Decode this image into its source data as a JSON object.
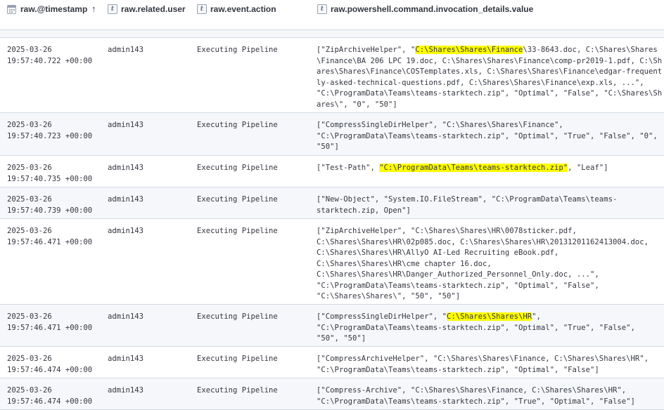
{
  "columns": [
    {
      "label": "raw.@timestamp",
      "type_icon": "calendar-icon",
      "sort": "ascending"
    },
    {
      "label": "raw.related.user",
      "type_icon": "text-type-icon"
    },
    {
      "label": "raw.event.action",
      "type_icon": "text-type-icon"
    },
    {
      "label": "raw.powershell.command.invocation_details.value",
      "type_icon": "text-type-icon"
    }
  ],
  "partial_row_fragment": "...\" ...\"",
  "highlight_color": "#fdfd00",
  "rows": [
    {
      "timestamp_date": "2025-03-26",
      "timestamp_time": "19:57:40.722 +00:00",
      "user": "admin143",
      "action": "Executing Pipeline",
      "value_before": "[\"ZipArchiveHelper\", \"",
      "value_highlight": "C:\\Shares\\Shares\\Finance",
      "value_after": "\\33-8643.doc, C:\\Shares\\Shares\\Finance\\BA 206 LPC 19.doc, C:\\Shares\\Shares\\Finance\\comp-pr2019-1.pdf, C:\\Shares\\Shares\\Finance\\COSTemplates.xls, C:\\Shares\\Shares\\Finance\\edgar-frequently-asked-technical-questions.pdf, C:\\Shares\\Shares\\Finance\\exp.xls, ...\", \"C:\\ProgramData\\Teams\\teams-starktech.zip\", \"Optimal\", \"False\", \"C:\\Shares\\Shares\\\", \"0\", \"50\"]",
      "value_lines": [
        "[\"ZipArchiveHelper\", \"",
        "C:\\Shares\\Shares\\Finance\\BA 206 LPC 19.doc, C:\\Shares\\Shares\\Finance\\comp-",
        "pr2019-1.pdf, C:\\Shares\\Shares\\Finance\\COSTemplates.xls,",
        "C:\\Shares\\Shares\\Finance\\edgar-frequently-asked-technical-questions.pdf,",
        "C:\\Shares\\Shares\\Finance\\exp.xls, ...\", \"C:\\ProgramData\\Teams\\teams-",
        "starktech.zip\", \"Optimal\", \"False\", \"C:\\Shares\\Shares\\\", \"0\", \"50\"]"
      ]
    },
    {
      "timestamp_date": "2025-03-26",
      "timestamp_time": "19:57:40.723 +00:00",
      "user": "admin143",
      "action": "Executing Pipeline",
      "value_lines": [
        "[\"CompressSingleDirHelper\", \"C:\\Shares\\Shares\\Finance\",",
        "\"C:\\ProgramData\\Teams\\teams-starktech.zip\", \"Optimal\", \"True\", \"False\", \"0\",",
        "\"50\"]"
      ]
    },
    {
      "timestamp_date": "2025-03-26",
      "timestamp_time": "19:57:40.735 +00:00",
      "user": "admin143",
      "action": "Executing Pipeline",
      "value_before": "[\"Test-Path\", ",
      "value_highlight": "\"C:\\ProgramData\\Teams\\teams-starktech.zip\"",
      "value_after": ", \"Leaf\"]"
    },
    {
      "timestamp_date": "2025-03-26",
      "timestamp_time": "19:57:40.739 +00:00",
      "user": "admin143",
      "action": "Executing Pipeline",
      "value_lines": [
        "[\"New-Object\", \"System.IO.FileStream\", \"C:\\ProgramData\\Teams\\teams-",
        "starktech.zip, Open\"]"
      ]
    },
    {
      "timestamp_date": "2025-03-26",
      "timestamp_time": "19:57:46.471 +00:00",
      "user": "admin143",
      "action": "Executing Pipeline",
      "value_lines": [
        "[\"ZipArchiveHelper\", \"C:\\Shares\\Shares\\HR\\0078sticker.pdf,",
        "C:\\Shares\\Shares\\HR\\02p085.doc, C:\\Shares\\Shares\\HR\\20131201162413004.doc,",
        "C:\\Shares\\Shares\\HR\\AllyO AI-Led Recruiting eBook.pdf,",
        "C:\\Shares\\Shares\\HR\\cme chapter 16.doc,",
        "C:\\Shares\\Shares\\HR\\Danger_Authorized_Personnel_Only.doc, ...\",",
        "\"C:\\ProgramData\\Teams\\teams-starktech.zip\", \"Optimal\", \"False\",",
        "\"C:\\Shares\\Shares\\\", \"50\", \"50\"]"
      ]
    },
    {
      "timestamp_date": "2025-03-26",
      "timestamp_time": "19:57:46.471 +00:00",
      "user": "admin143",
      "action": "Executing Pipeline",
      "value_before": "[\"CompressSingleDirHelper\", \"",
      "value_highlight": "C:\\Shares\\Shares\\HR",
      "value_after": "\",\n\"C:\\ProgramData\\Teams\\teams-starktech.zip\", \"Optimal\", \"True\", \"False\",\n\"50\", \"50\"]"
    },
    {
      "timestamp_date": "2025-03-26",
      "timestamp_time": "19:57:46.474 +00:00",
      "user": "admin143",
      "action": "Executing Pipeline",
      "value_lines": [
        "[\"CompressArchiveHelper\", \"C:\\Shares\\Shares\\Finance, C:\\Shares\\Shares\\HR\",",
        "\"C:\\ProgramData\\Teams\\teams-starktech.zip\", \"Optimal\", \"False\"]"
      ]
    },
    {
      "timestamp_date": "2025-03-26",
      "timestamp_time": "19:57:46.474 +00:00",
      "user": "admin143",
      "action": "Executing Pipeline",
      "value_lines": [
        "[\"Compress-Archive\", \"C:\\Shares\\Shares\\Finance, C:\\Shares\\Shares\\HR\",",
        "\"C:\\ProgramData\\Teams\\teams-starktech.zip\", \"True\", \"Optimal\", \"False\"]"
      ]
    }
  ]
}
